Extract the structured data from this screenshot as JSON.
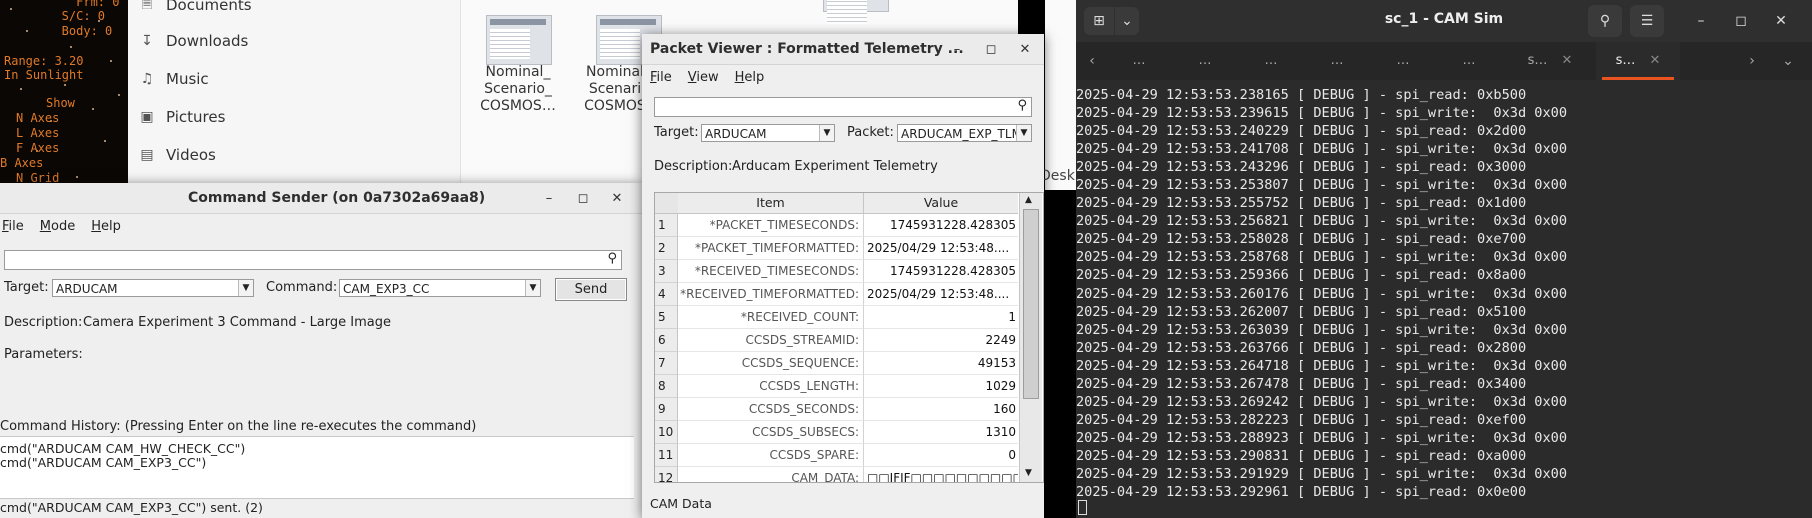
{
  "space": {
    "lines": [
      "     Frm: 0",
      "   S/C: 0",
      "   Body: 0"
    ],
    "range_line": "Range: 3.20",
    "sunlight": "In Sunlight",
    "show": "Show",
    "axes": [
      "N Axes",
      "L Axes",
      "F Axes",
      "B Axes",
      "N Grid"
    ]
  },
  "file_manager": {
    "sidebar": [
      {
        "label": "Documents",
        "icon": "document-icon"
      },
      {
        "label": "Downloads",
        "icon": "download-icon"
      },
      {
        "label": "Music",
        "icon": "music-icon"
      },
      {
        "label": "Pictures",
        "icon": "picture-icon"
      },
      {
        "label": "Videos",
        "icon": "video-icon"
      }
    ],
    "files": [
      {
        "name_line1": "Nominal_",
        "name_line2": "Scenario_",
        "name_line3": "COSMOS…"
      },
      {
        "name_line1": "Nominal",
        "name_line2": "Scenari",
        "name_line3": "COSMOS"
      }
    ],
    "desk_fragment": "Desk"
  },
  "command_sender": {
    "title": "Command Sender (on 0a7302a69aa8)",
    "menu": [
      "File",
      "Mode",
      "Help"
    ],
    "target_label": "Target:",
    "target_value": "ARDUCAM",
    "command_label": "Command:",
    "command_value": "CAM_EXP3_CC",
    "send_label": "Send",
    "description_label": "Description:",
    "description_value": "Camera Experiment 3 Command - Large Image",
    "parameters_label": "Parameters:",
    "history_label": "Command History: (Pressing Enter on the line re-executes the command)",
    "history": [
      "cmd(\"ARDUCAM CAM_HW_CHECK_CC\")",
      "cmd(\"ARDUCAM CAM_EXP3_CC\")"
    ],
    "status": "cmd(\"ARDUCAM CAM_EXP3_CC\") sent. (2)"
  },
  "packet_viewer": {
    "title": "Packet Viewer : Formatted Telemetry ...",
    "menu": [
      "File",
      "View",
      "Help"
    ],
    "target_label": "Target:",
    "target_value": "ARDUCAM",
    "packet_label": "Packet:",
    "packet_value": "ARDUCAM_EXP_TLM",
    "description_label": "Description:",
    "description_value": "Arducam Experiment Telemetry",
    "col_item": "Item",
    "col_value": "Value",
    "rows": [
      {
        "n": "1",
        "item": "*PACKET_TIMESECONDS:",
        "value": "1745931228.428305",
        "align": "right"
      },
      {
        "n": "2",
        "item": "*PACKET_TIMEFORMATTED:",
        "value": "2025/04/29 12:53:48....",
        "align": "left"
      },
      {
        "n": "3",
        "item": "*RECEIVED_TIMESECONDS:",
        "value": "1745931228.428305",
        "align": "right"
      },
      {
        "n": "4",
        "item": "*RECEIVED_TIMEFORMATTED:",
        "value": "2025/04/29 12:53:48....",
        "align": "left"
      },
      {
        "n": "5",
        "item": "*RECEIVED_COUNT:",
        "value": "1",
        "align": "right"
      },
      {
        "n": "6",
        "item": "CCSDS_STREAMID:",
        "value": "2249",
        "align": "right"
      },
      {
        "n": "7",
        "item": "CCSDS_SEQUENCE:",
        "value": "49153",
        "align": "right"
      },
      {
        "n": "8",
        "item": "CCSDS_LENGTH:",
        "value": "1029",
        "align": "right"
      },
      {
        "n": "9",
        "item": "CCSDS_SECONDS:",
        "value": "160",
        "align": "right"
      },
      {
        "n": "10",
        "item": "CCSDS_SUBSECS:",
        "value": "1310",
        "align": "right"
      },
      {
        "n": "11",
        "item": "CCSDS_SPARE:",
        "value": "0",
        "align": "right"
      },
      {
        "n": "12",
        "item": "CAM_DATA:",
        "value": "□□JFIF□□□□□□□□□□□C□...",
        "align": "left"
      }
    ],
    "status": "CAM Data"
  },
  "terminal": {
    "title": "sc_1 - CAM Sim",
    "tabs": [
      "…",
      "…",
      "…",
      "…",
      "…",
      "…",
      "s…",
      "s…"
    ],
    "lines": [
      "2025-04-29 12:53:53.238165 [ DEBUG ] - spi_read: 0xb500",
      "2025-04-29 12:53:53.239615 [ DEBUG ] - spi_write:  0x3d 0x00",
      "2025-04-29 12:53:53.240229 [ DEBUG ] - spi_read: 0x2d00",
      "2025-04-29 12:53:53.241708 [ DEBUG ] - spi_write:  0x3d 0x00",
      "2025-04-29 12:53:53.243296 [ DEBUG ] - spi_read: 0x3000",
      "2025-04-29 12:53:53.253807 [ DEBUG ] - spi_write:  0x3d 0x00",
      "2025-04-29 12:53:53.255752 [ DEBUG ] - spi_read: 0x1d00",
      "2025-04-29 12:53:53.256821 [ DEBUG ] - spi_write:  0x3d 0x00",
      "2025-04-29 12:53:53.258028 [ DEBUG ] - spi_read: 0xe700",
      "2025-04-29 12:53:53.258768 [ DEBUG ] - spi_write:  0x3d 0x00",
      "2025-04-29 12:53:53.259366 [ DEBUG ] - spi_read: 0x8a00",
      "2025-04-29 12:53:53.260176 [ DEBUG ] - spi_write:  0x3d 0x00",
      "2025-04-29 12:53:53.262007 [ DEBUG ] - spi_read: 0x5100",
      "2025-04-29 12:53:53.263039 [ DEBUG ] - spi_write:  0x3d 0x00",
      "2025-04-29 12:53:53.263766 [ DEBUG ] - spi_read: 0x2800",
      "2025-04-29 12:53:53.264718 [ DEBUG ] - spi_write:  0x3d 0x00",
      "2025-04-29 12:53:53.267478 [ DEBUG ] - spi_read: 0x3400",
      "2025-04-29 12:53:53.269242 [ DEBUG ] - spi_write:  0x3d 0x00",
      "2025-04-29 12:53:53.282223 [ DEBUG ] - spi_read: 0xef00",
      "2025-04-29 12:53:53.288923 [ DEBUG ] - spi_write:  0x3d 0x00",
      "2025-04-29 12:53:53.290831 [ DEBUG ] - spi_read: 0xa000",
      "2025-04-29 12:53:53.291929 [ DEBUG ] - spi_write:  0x3d 0x00",
      "2025-04-29 12:53:53.292961 [ DEBUG ] - spi_read: 0x0e00"
    ],
    "accent_color": "#e95420"
  }
}
